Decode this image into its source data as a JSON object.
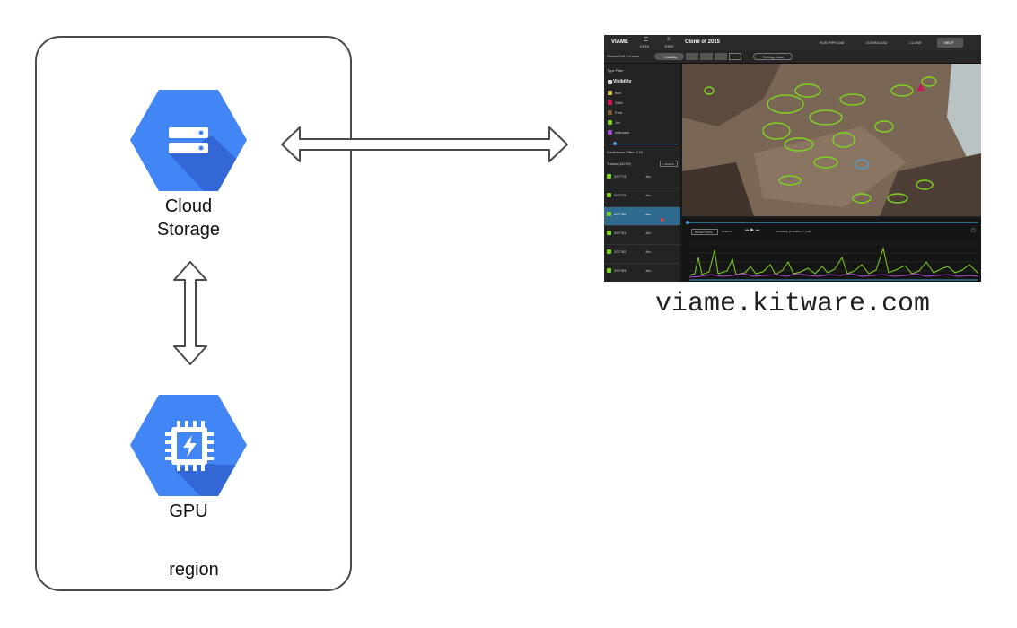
{
  "diagram": {
    "region_label": "region",
    "storage_label_line1": "Cloud",
    "storage_label_line2": "Storage",
    "gpu_label": "GPU",
    "url_label": "viame.kitware.com",
    "colors": {
      "hex_blue": "#4285f4",
      "hex_shadow": "#3367d6",
      "border": "#4a4a4a"
    },
    "icons": [
      "cloud-storage-icon",
      "gpu-icon"
    ]
  },
  "viame_ui": {
    "app_name": "VIAME",
    "nav_data": "DATA",
    "nav_jobs": "JOBS",
    "dataset_title": "Clone of 2015",
    "run_pipeline": "RUN PIPELINE",
    "download": "DOWNLOAD",
    "clone": "CLONE",
    "help": "HELP",
    "viewer_controls": "Viewer/Edit Controls",
    "visibility_btn": "Visibility",
    "editing_mode": "Editing Mode",
    "type_filter": "Type Filter",
    "visibility_header": "Visibility",
    "types": [
      {
        "label": "Bull",
        "color": "#d7c63a"
      },
      {
        "label": "SAM",
        "color": "#d0145a"
      },
      {
        "label": "Fem",
        "color": "#7a5b3a"
      },
      {
        "label": "Juv",
        "color": "#7ed321"
      },
      {
        "label": "unknown",
        "color": "#a24ad8"
      }
    ],
    "confidence": "Confidence Filter: 0.10",
    "tracks_header": "Tracks (18749)",
    "new_track": "+ TRACK",
    "tracks": [
      {
        "id": "207778",
        "type": "Juv"
      },
      {
        "id": "207779",
        "type": "Juv"
      },
      {
        "id": "207780",
        "type": "Juv"
      },
      {
        "id": "207781",
        "type": "Juv"
      },
      {
        "id": "207782",
        "type": "Juv"
      },
      {
        "id": "207783",
        "type": "Juv"
      }
    ],
    "detections_btn": "DETECTIONS",
    "events_btn": "EVENTS",
    "frame_name": "20150818_20150819_T_C00"
  }
}
